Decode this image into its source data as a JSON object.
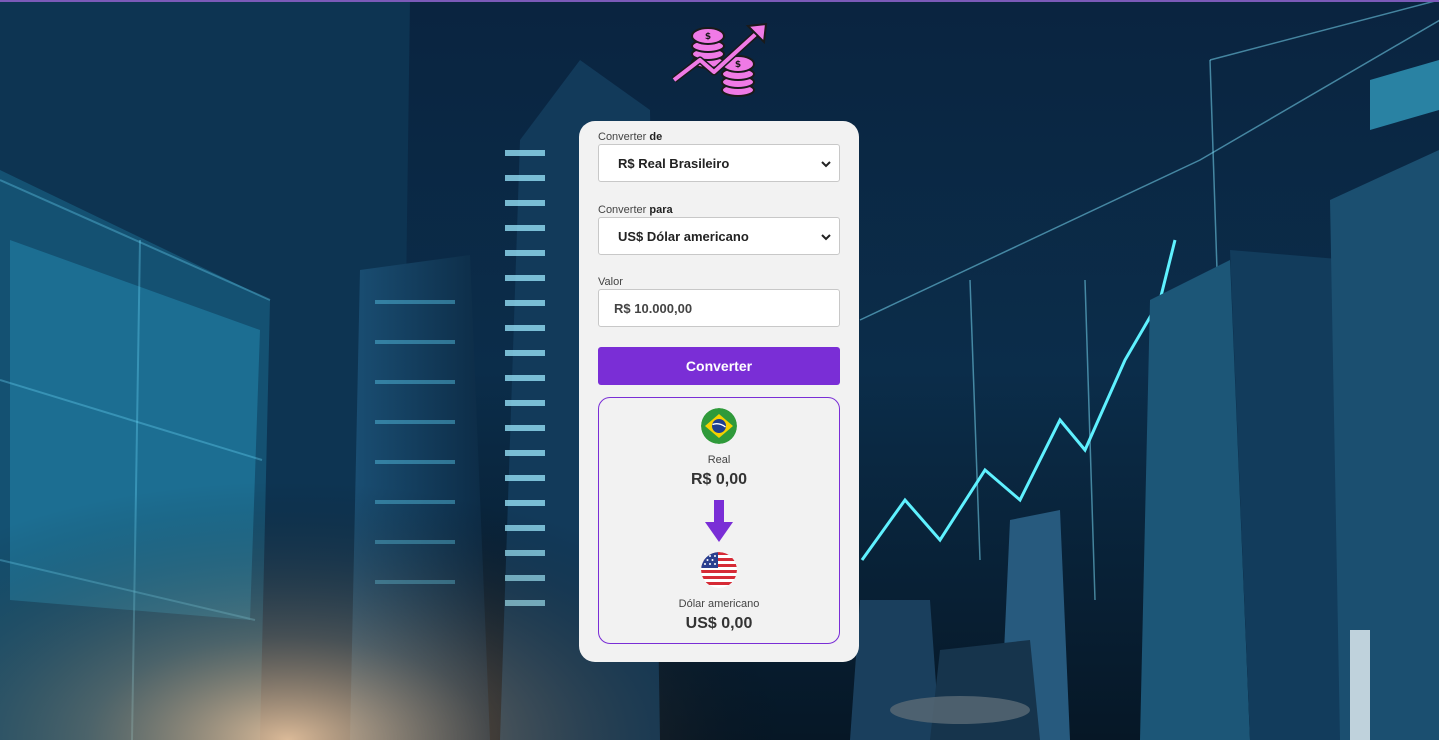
{
  "form": {
    "from_label": "Converter",
    "from_label_bold": "de",
    "from_value": "R$ Real Brasileiro",
    "to_label": "Converter",
    "to_label_bold": "para",
    "to_value": "US$ Dólar americano",
    "amount_label": "Valor",
    "amount_value": "R$ 10.000,00",
    "convert_button": "Converter"
  },
  "result": {
    "from_currency_name": "Real",
    "from_currency_value": "R$ 0,00",
    "to_currency_name": "Dólar americano",
    "to_currency_value": "US$ 0,00",
    "from_flag": "brazil-flag-icon",
    "to_flag": "usa-flag-icon",
    "arrow_icon": "arrow-down-icon"
  },
  "colors": {
    "accent": "#7a2ed6",
    "card_bg": "#f2f2f2",
    "logo_pink": "#f07ae6"
  },
  "icons": {
    "logo": "coins-growth-logo-icon",
    "dropdown": "chevron-down-icon"
  }
}
